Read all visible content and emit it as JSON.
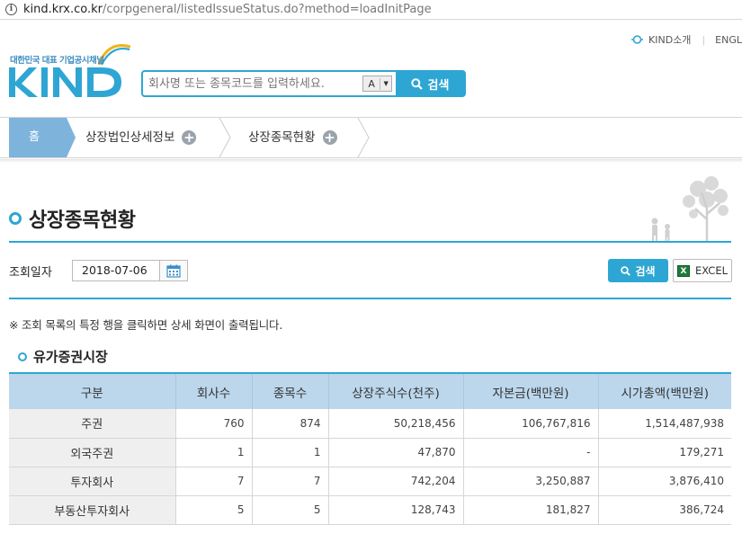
{
  "browser": {
    "host": "kind.krx.co.kr",
    "path": "/corpgeneral/listedIssueStatus.do?method=loadInitPage"
  },
  "top_links": {
    "intro": "KIND소개",
    "english": "ENGL"
  },
  "logo": {
    "tagline": "대한민국 대표 기업공시채널",
    "wordmark": "KIND"
  },
  "search": {
    "placeholder": "회사명 또는 종목코드를 입력하세요.",
    "font_toggle": "A",
    "button": "검색"
  },
  "breadcrumb": {
    "home": "홈",
    "items": [
      "상장법인상세정보",
      "상장종목현황"
    ]
  },
  "page_title": "상장종목현황",
  "query": {
    "label": "조회일자",
    "date": "2018-07-06",
    "search_button": "검색",
    "excel_button": "EXCEL"
  },
  "note": "※ 조회 목록의 특정 행을 클릭하면 상세 화면이 출력됩니다.",
  "section_title": "유가증권시장",
  "table": {
    "headers": [
      "구분",
      "회사수",
      "종목수",
      "상장주식수(천주)",
      "자본금(백만원)",
      "시가총액(백만원)"
    ],
    "rows": [
      [
        "주권",
        "760",
        "874",
        "50,218,456",
        "106,767,816",
        "1,514,487,938"
      ],
      [
        "외국주권",
        "1",
        "1",
        "47,870",
        "-",
        "179,271"
      ],
      [
        "투자회사",
        "7",
        "7",
        "742,204",
        "3,250,887",
        "3,876,410"
      ],
      [
        "부동산투자회사",
        "5",
        "5",
        "128,743",
        "181,827",
        "386,724"
      ]
    ]
  },
  "colors": {
    "accent": "#2ea6d4",
    "header_bg": "#bcd7ec",
    "home_crumb": "#7eb4dc"
  },
  "icons": [
    "info-icon",
    "kind-intro-icon",
    "search-icon",
    "plus-icon",
    "calendar-icon",
    "excel-icon",
    "tree-illustration"
  ]
}
